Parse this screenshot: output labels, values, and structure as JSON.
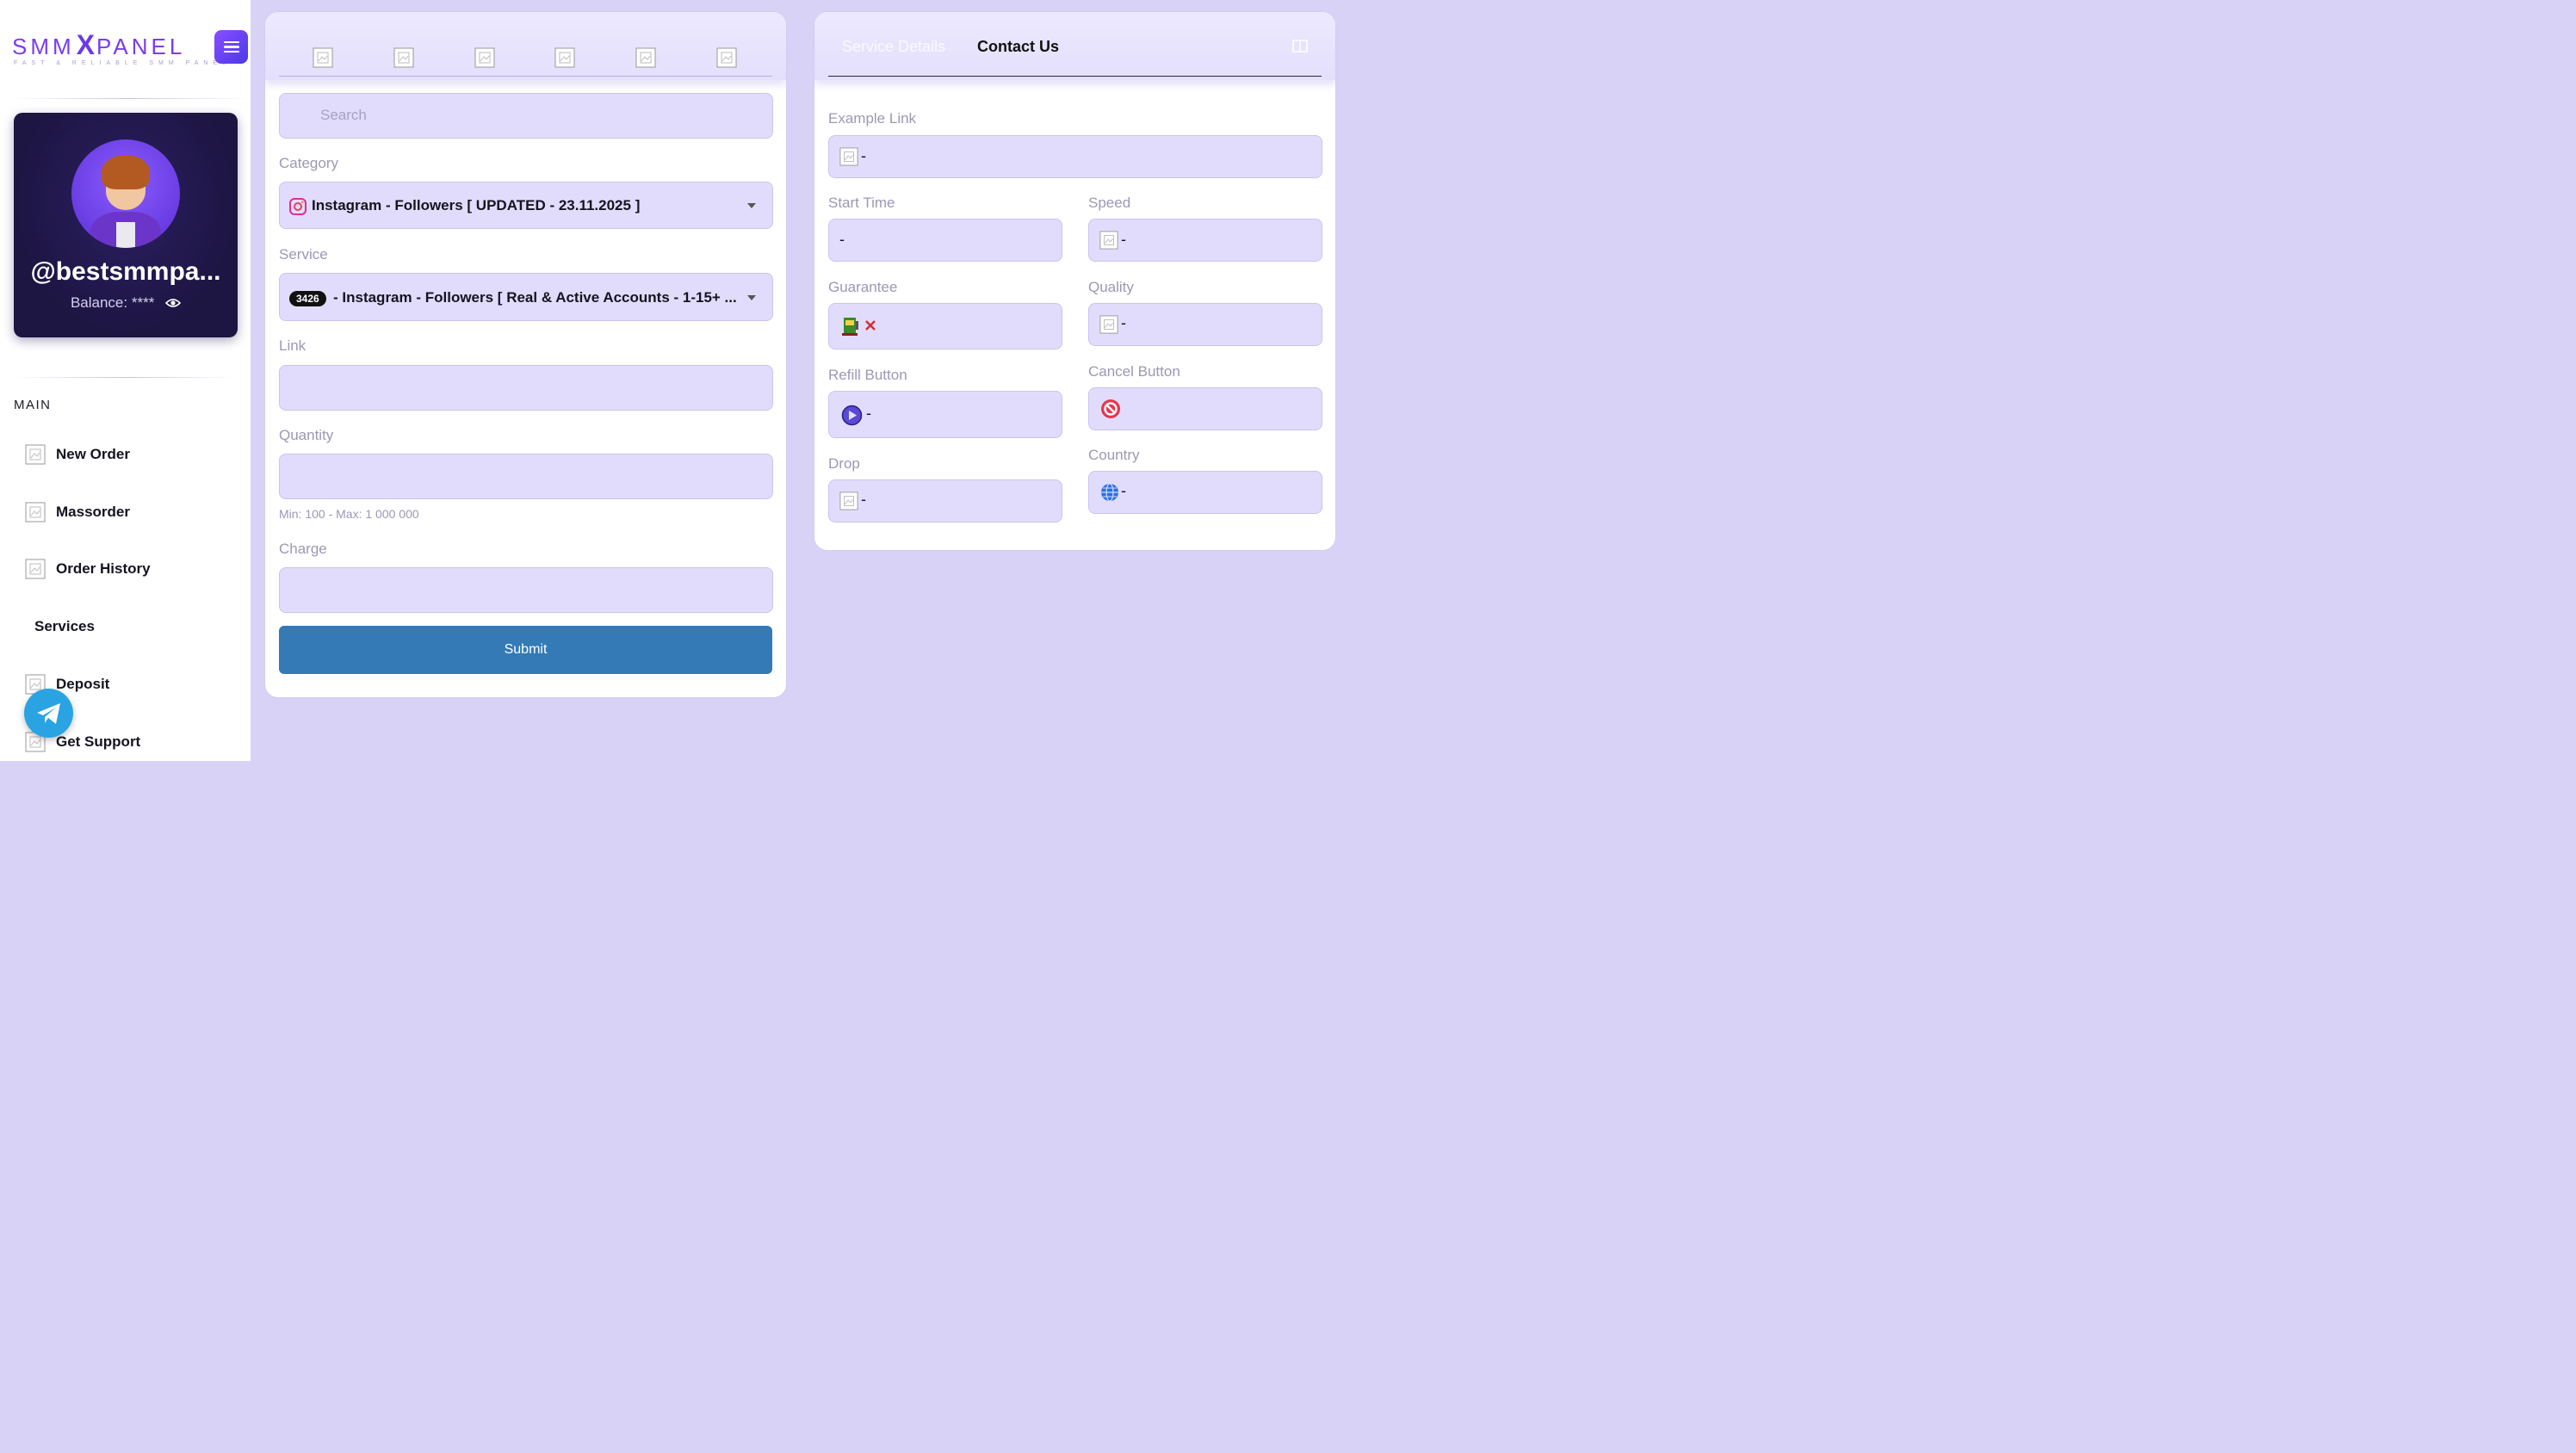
{
  "brand": {
    "name_left": "SMM",
    "name_x": "X",
    "name_right": "PANEL",
    "tagline": "FAST & RELIABLE SMM PANEL"
  },
  "profile": {
    "username": "@bestsmmpa...",
    "balance_label": "Balance:",
    "balance_value": "****"
  },
  "nav": {
    "section": "MAIN",
    "items": [
      {
        "label": "New Order",
        "icon": "image-placeholder-icon"
      },
      {
        "label": "Massorder",
        "icon": "image-placeholder-icon"
      },
      {
        "label": "Order History",
        "icon": "image-placeholder-icon"
      },
      {
        "label": "Services",
        "icon": ""
      },
      {
        "label": "Deposit",
        "icon": "image-placeholder-icon"
      },
      {
        "label": "Get Support",
        "icon": "image-placeholder-icon"
      }
    ]
  },
  "order_form": {
    "search_placeholder": "Search",
    "category_label": "Category",
    "category_value": "Instagram - Followers [ UPDATED - 23.11.2025 ]",
    "service_label": "Service",
    "service_id": "3426",
    "service_value": "- Instagram - Followers [ Real & Active Accounts - 1-15+ ...",
    "link_label": "Link",
    "link_value": "",
    "quantity_label": "Quantity",
    "quantity_value": "",
    "quantity_hint": "Min: 100 - Max: 1 000 000",
    "charge_label": "Charge",
    "charge_value": "",
    "submit_label": "Submit"
  },
  "details": {
    "tab_service_details": "Service Details",
    "tab_contact_us": "Contact Us",
    "example_link_label": "Example Link",
    "example_link_value": "-",
    "start_time_label": "Start Time",
    "start_time_value": "-",
    "speed_label": "Speed",
    "speed_value": "-",
    "guarantee_label": "Guarantee",
    "quality_label": "Quality",
    "quality_value": "-",
    "refill_label": "Refill Button",
    "refill_value": "-",
    "cancel_label": "Cancel Button",
    "drop_label": "Drop",
    "drop_value": "-",
    "country_label": "Country",
    "country_value": "-"
  },
  "colors": {
    "accent": "#7a3cf0",
    "submit": "#337ab7",
    "page_bg": "#d9d2f7",
    "field_bg": "#e2dcfc",
    "telegram": "#2aa3e3"
  }
}
